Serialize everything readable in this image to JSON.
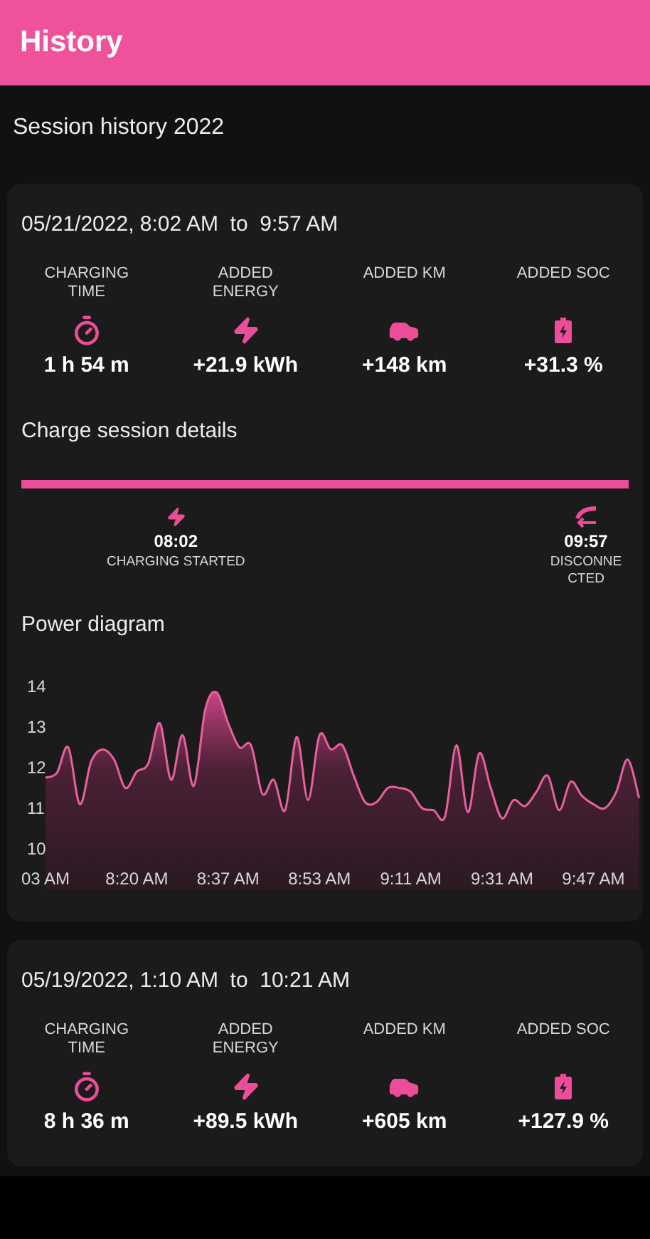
{
  "header": {
    "title": "History"
  },
  "section_title": "Session history 2022",
  "sessions": [
    {
      "range": "05/21/2022, 8:02 AM  to  9:57 AM",
      "stats": [
        {
          "kind": "time",
          "label": "CHARGING TIME",
          "value": "1 h 54 m"
        },
        {
          "kind": "energy",
          "label": "ADDED ENERGY",
          "value": "+21.9 kWh"
        },
        {
          "kind": "distance",
          "label": "ADDED KM",
          "value": "+148 km"
        },
        {
          "kind": "soc",
          "label": "ADDED SOC",
          "value": "+31.3 %"
        }
      ],
      "details": {
        "title": "Charge session details",
        "events": [
          {
            "kind": "start",
            "time": "08:02",
            "label": "CHARGING STARTED"
          },
          {
            "kind": "end",
            "time": "09:57",
            "label": "DISCONNECTED"
          }
        ]
      },
      "power": {
        "title": "Power diagram",
        "chart_data": {
          "type": "area",
          "yticks": [
            10,
            11,
            12,
            13,
            14
          ],
          "ylim": [
            10,
            14
          ],
          "categories": [
            "03 AM",
            null,
            null,
            null,
            null,
            null,
            null,
            null,
            "8:20 AM",
            null,
            null,
            null,
            null,
            null,
            null,
            null,
            "8:37 AM",
            null,
            null,
            null,
            null,
            null,
            null,
            null,
            "8:53 AM",
            null,
            null,
            null,
            null,
            null,
            null,
            null,
            "9:11 AM",
            null,
            null,
            null,
            null,
            null,
            null,
            null,
            "9:31 AM",
            null,
            null,
            null,
            null,
            null,
            null,
            null,
            "9:47 AM",
            null,
            null,
            null,
            null
          ],
          "series": [
            {
              "color": "#e8609f",
              "values": [
                11.75,
                11.87,
                12.5,
                11.1,
                12.15,
                12.45,
                12.2,
                11.5,
                11.9,
                12.1,
                13.1,
                11.7,
                12.8,
                11.55,
                13.45,
                13.85,
                13.1,
                12.5,
                12.55,
                11.35,
                11.7,
                10.95,
                12.75,
                11.2,
                12.8,
                12.45,
                12.55,
                11.8,
                11.15,
                11.15,
                11.5,
                11.5,
                11.4,
                11.0,
                10.95,
                10.8,
                12.55,
                10.9,
                12.35,
                11.5,
                10.75,
                11.2,
                11.05,
                11.4,
                11.8,
                10.95,
                11.65,
                11.3,
                11.1,
                11.0,
                11.4,
                12.2,
                11.25
              ]
            }
          ]
        }
      }
    },
    {
      "range": "05/19/2022, 1:10 AM  to  10:21 AM",
      "stats": [
        {
          "kind": "time",
          "label": "CHARGING TIME",
          "value": "8 h 36 m"
        },
        {
          "kind": "energy",
          "label": "ADDED ENERGY",
          "value": "+89.5 kWh"
        },
        {
          "kind": "distance",
          "label": "ADDED KM",
          "value": "+605 km"
        },
        {
          "kind": "soc",
          "label": "ADDED SOC",
          "value": "+127.9 %"
        }
      ]
    }
  ]
}
